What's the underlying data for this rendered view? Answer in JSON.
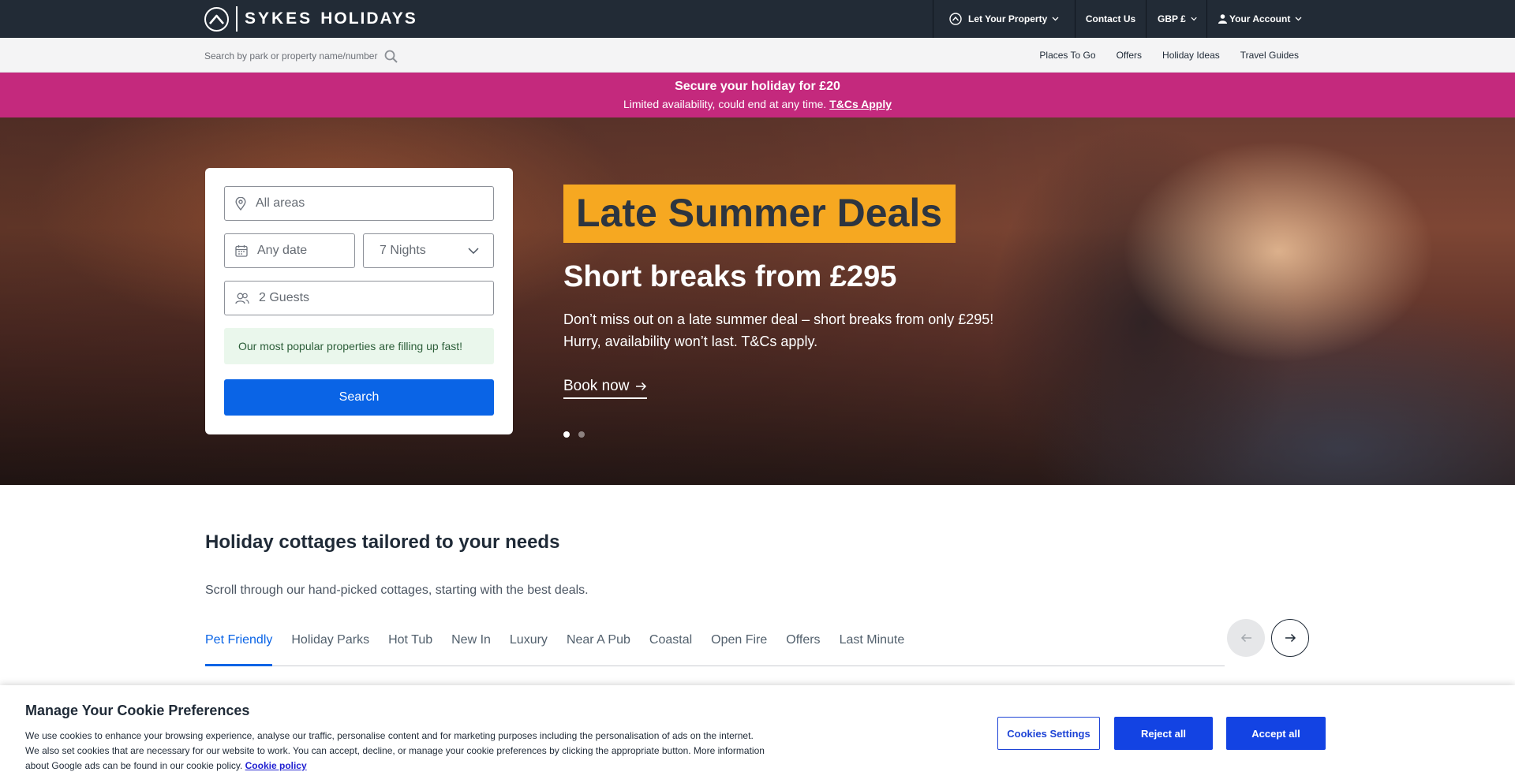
{
  "header": {
    "brand_left": "SYKES",
    "brand_right": "HOLIDAYS",
    "nav": {
      "let_property": "Let Your Property",
      "contact": "Contact Us",
      "currency": "GBP £",
      "account": "Your Account"
    }
  },
  "subnav": {
    "search_placeholder": "Search by park or property name/number",
    "links": [
      "Places To Go",
      "Offers",
      "Holiday Ideas",
      "Travel Guides"
    ]
  },
  "promo": {
    "title": "Secure your holiday for £20",
    "text": "Limited availability, could end at any time.",
    "link": "T&Cs Apply"
  },
  "search": {
    "area_placeholder": "All areas",
    "date_placeholder": "Any date",
    "nights": "7 Nights",
    "guests": "2 Guests",
    "notice": "Our most popular properties are filling up fast!",
    "button": "Search"
  },
  "hero": {
    "badge": "Late Summer Deals",
    "heading": "Short breaks from £295",
    "line1": "Don’t miss out on a late summer deal – short breaks from only £295!",
    "line2": "Hurry, availability won’t last. T&Cs apply.",
    "cta": "Book now",
    "slide_active": 1,
    "slide_count": 2
  },
  "section": {
    "title": "Holiday cottages tailored to your needs",
    "subtitle": "Scroll through our hand-picked cottages, starting with the best deals.",
    "tabs": [
      "Pet Friendly",
      "Holiday Parks",
      "Hot Tub",
      "New In",
      "Luxury",
      "Near A Pub",
      "Coastal",
      "Open Fire",
      "Offers",
      "Last Minute"
    ],
    "active_tab": "Pet Friendly"
  },
  "cookie": {
    "title": "Manage Your Cookie Preferences",
    "line1": "We use cookies to enhance your browsing experience, analyse our traffic, personalise content and for marketing purposes including the personalisation of ads on the internet.",
    "line2": "We also set cookies that are necessary for our website to work. You can accept, decline, or manage your cookie preferences by clicking the appropriate button. More information",
    "line3": "about Google ads can be found in our cookie policy.",
    "policy_link": "Cookie policy",
    "settings": "Cookies Settings",
    "reject": "Reject all",
    "accept": "Accept all"
  },
  "colors": {
    "navbar": "#222b36",
    "promo": "#c4297d",
    "accent_blue": "#0a64e6",
    "badge_yellow": "#f6a821",
    "cookie_blue": "#1343e3"
  },
  "icons": [
    "sykes-logo-icon",
    "property-icon",
    "chevron-down-icon",
    "user-icon",
    "search-icon",
    "location-pin-icon",
    "calendar-icon",
    "guests-icon",
    "arrow-right-icon",
    "arrow-left-icon"
  ]
}
